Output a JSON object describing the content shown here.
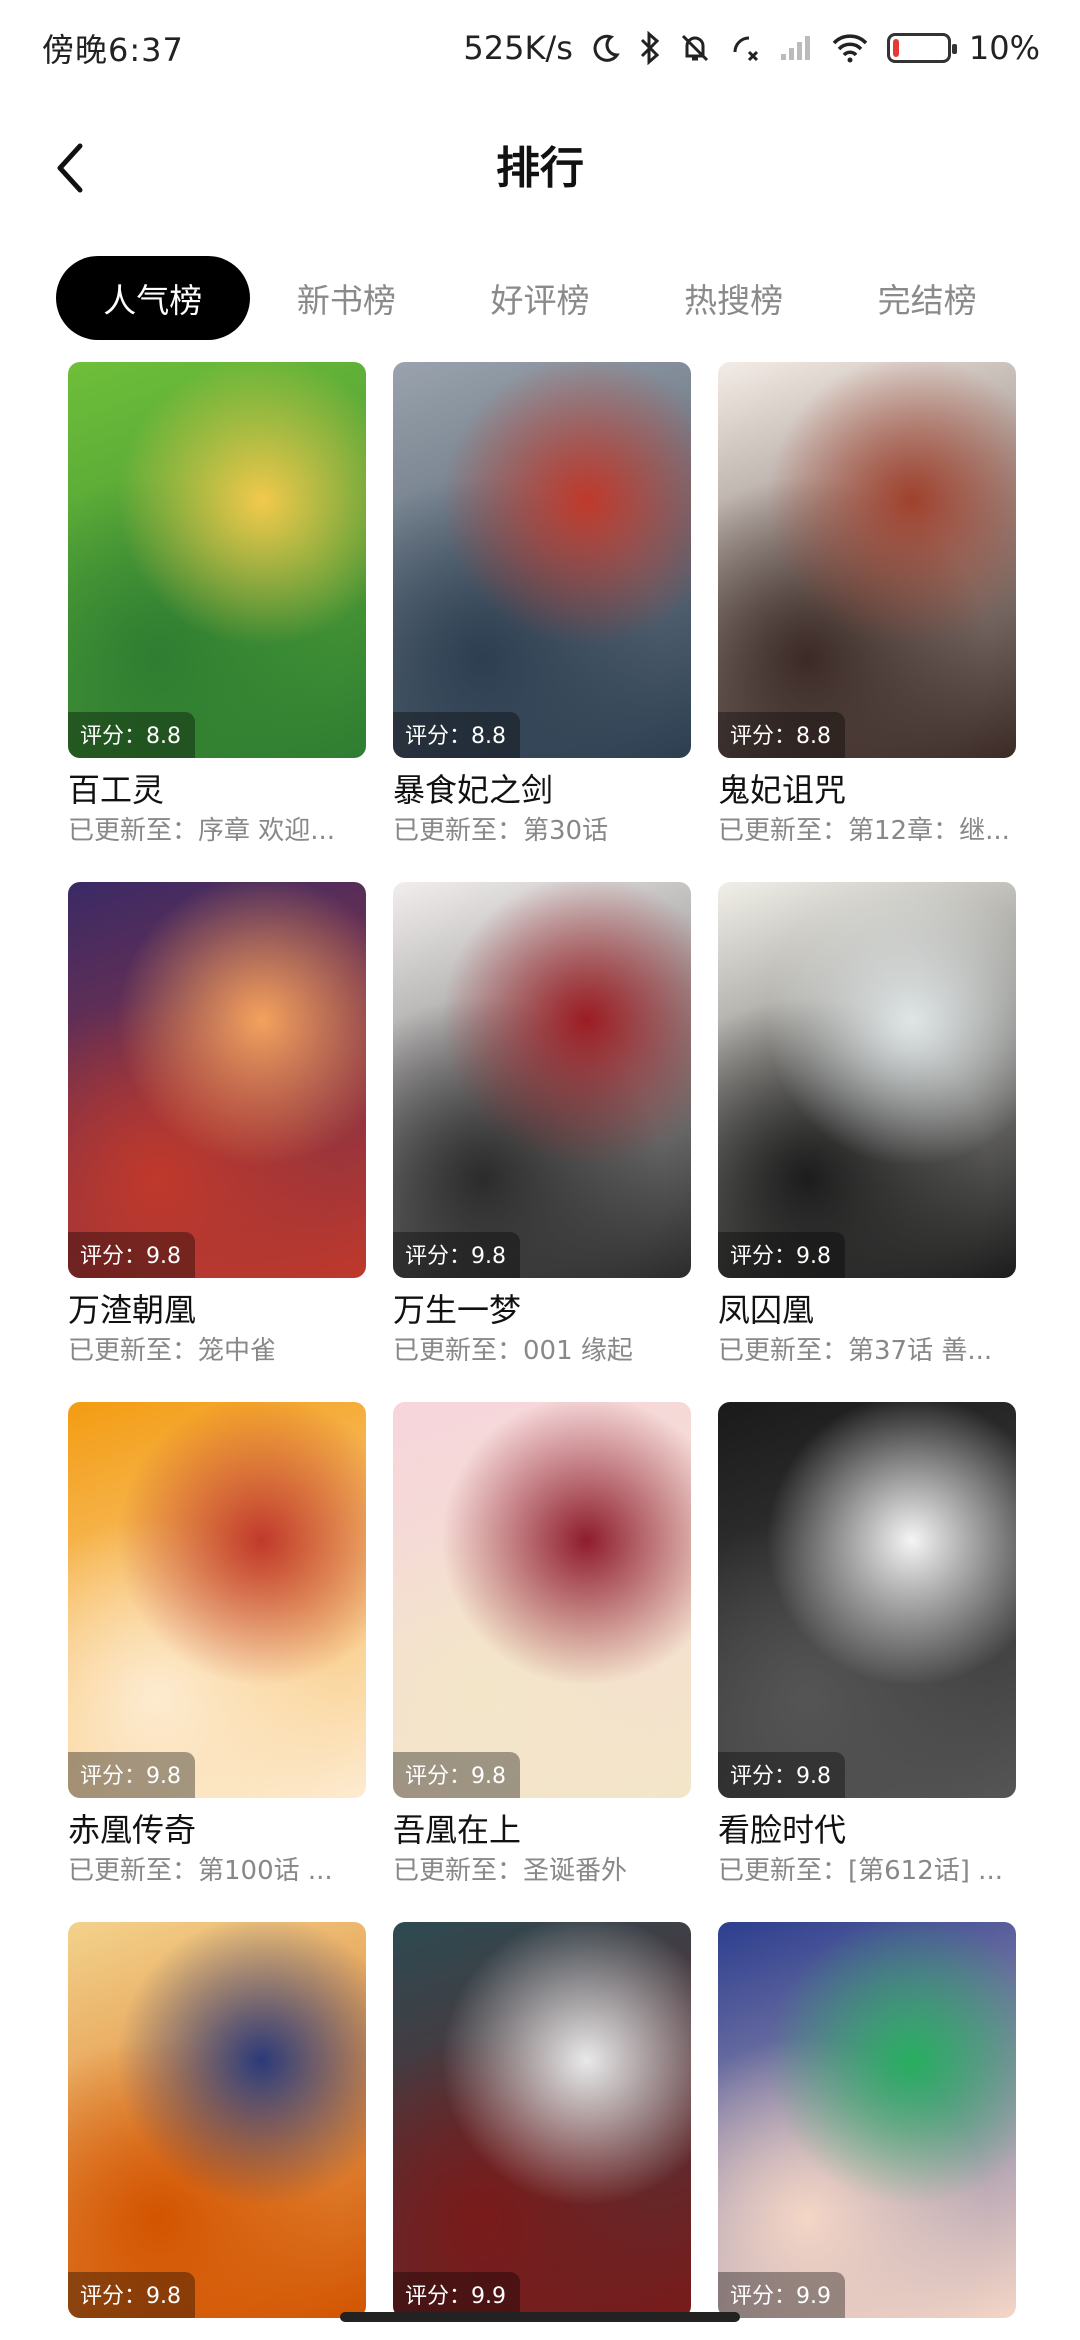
{
  "status": {
    "time": "傍晚6:37",
    "network_speed": "525K/s",
    "battery": "10%",
    "icons": [
      "moon-icon",
      "bluetooth-icon",
      "mute-bell-icon",
      "call-icon",
      "signal-icon",
      "wifi-icon",
      "battery-icon"
    ]
  },
  "header": {
    "title": "排行",
    "back_icon": "chevron-left-icon"
  },
  "tabs": [
    {
      "label": "人气榜",
      "active": true
    },
    {
      "label": "新书榜",
      "active": false
    },
    {
      "label": "好评榜",
      "active": false
    },
    {
      "label": "热搜榜",
      "active": false
    },
    {
      "label": "完结榜",
      "active": false
    }
  ],
  "comics": [
    {
      "title": "百工灵",
      "update": "已更新至：序章 欢迎...",
      "score": "评分：8.8",
      "colors": [
        "#6fbf3a",
        "#f2c94c",
        "#2e7d32"
      ]
    },
    {
      "title": "暴食妃之剑",
      "update": "已更新至：第30话",
      "score": "评分：8.8",
      "colors": [
        "#9aa3ad",
        "#c0392b",
        "#2c3e50"
      ]
    },
    {
      "title": "鬼妃诅咒",
      "update": "已更新至：第12章：继...",
      "score": "评分：8.8",
      "colors": [
        "#f4ece6",
        "#a0412d",
        "#3b2a25"
      ]
    },
    {
      "title": "万渣朝凰",
      "update": "已更新至：笼中雀",
      "score": "评分：9.8",
      "colors": [
        "#3a2a66",
        "#f5a25d",
        "#c0392b"
      ]
    },
    {
      "title": "万生一梦",
      "update": "已更新至：001 缘起",
      "score": "评分：9.8",
      "colors": [
        "#f2eeee",
        "#9b1c22",
        "#2b2b2b"
      ]
    },
    {
      "title": "凤囚凰",
      "update": "已更新至：第37话 善...",
      "score": "评分：9.8",
      "colors": [
        "#f1efe8",
        "#dfe5e6",
        "#1c1c1c"
      ]
    },
    {
      "title": "赤凰传奇",
      "update": "已更新至：第100话 ...",
      "score": "评分：9.8",
      "colors": [
        "#f39c12",
        "#c0392b",
        "#fdebd0"
      ]
    },
    {
      "title": "吾凰在上",
      "update": "已更新至：圣诞番外",
      "score": "评分：9.8",
      "colors": [
        "#f6d5dc",
        "#8e1c2c",
        "#f3e6c8"
      ]
    },
    {
      "title": "看脸时代",
      "update": "已更新至：[第612话] ...",
      "score": "评分：9.8",
      "colors": [
        "#1a1a1a",
        "#f5f5f5",
        "#555555"
      ]
    },
    {
      "title": "",
      "update": "",
      "score": "评分：9.8",
      "colors": [
        "#f3d28c",
        "#2b3a7a",
        "#d35400"
      ]
    },
    {
      "title": "",
      "update": "",
      "score": "评分：9.9",
      "colors": [
        "#2d4a52",
        "#e9e9e9",
        "#7a1a1a"
      ]
    },
    {
      "title": "",
      "update": "",
      "score": "评分：9.9",
      "colors": [
        "#2c3e8f",
        "#27ae60",
        "#f5d6c6"
      ]
    }
  ]
}
